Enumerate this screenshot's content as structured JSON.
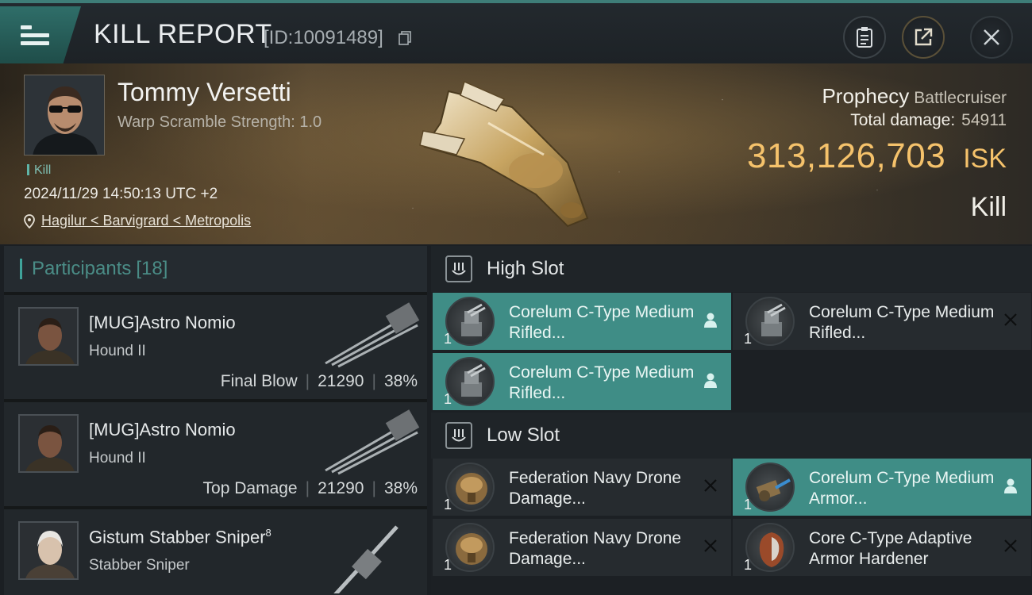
{
  "header": {
    "title": "KILL REPORT",
    "report_id": "[ID:10091489]",
    "icons": [
      "menu-icon",
      "copy-icon",
      "clipboard-icon",
      "share-icon",
      "close-icon"
    ]
  },
  "victim": {
    "name": "Tommy Versetti",
    "warp_scramble": "Warp Scramble Strength: 1.0",
    "tag": "Kill",
    "timestamp": "2024/11/29 14:50:13 UTC +2",
    "location": "Hagilur < Barvigrard < Metropolis",
    "ship_name": "Prophecy",
    "ship_class": "Battlecruiser",
    "total_damage_label": "Total damage:",
    "total_damage": "54911",
    "isk_value": "313,126,703",
    "isk_unit": "ISK",
    "kill_type": "Kill"
  },
  "participants": {
    "label": "Participants",
    "count": "[18]",
    "rows": [
      {
        "name": "[MUG]Astro Nomio",
        "ship": "Hound II",
        "tag": "Final Blow",
        "damage": "21290",
        "percent": "38%"
      },
      {
        "name": "[MUG]Astro Nomio",
        "ship": "Hound II",
        "tag": "Top Damage",
        "damage": "21290",
        "percent": "38%"
      },
      {
        "name": "Gistum Stabber Sniper",
        "name_sup": "8",
        "ship": "Stabber Sniper",
        "tag": "",
        "damage": "",
        "percent": ""
      }
    ]
  },
  "fitting": {
    "high_slot": {
      "label": "High Slot",
      "modules": [
        {
          "name": "Corelum C-Type Medium Rifled...",
          "qty": "1",
          "state": "dropped"
        },
        {
          "name": "Corelum C-Type Medium Rifled...",
          "qty": "1",
          "state": "destroyed"
        },
        {
          "name": "Corelum C-Type Medium Rifled...",
          "qty": "1",
          "state": "dropped"
        }
      ]
    },
    "low_slot": {
      "label": "Low Slot",
      "modules": [
        {
          "name": "Federation Navy Drone Damage...",
          "qty": "1",
          "state": "destroyed"
        },
        {
          "name": "Corelum C-Type Medium Armor...",
          "qty": "1",
          "state": "dropped"
        },
        {
          "name": "Federation Navy Drone Damage...",
          "qty": "1",
          "state": "destroyed"
        },
        {
          "name": "Core C-Type Adaptive Armor Hardener",
          "qty": "1",
          "state": "destroyed"
        }
      ]
    }
  },
  "colors": {
    "accent_teal": "#3f8d86",
    "isk_gold": "#f5c26b",
    "background": "#1b1f23"
  }
}
